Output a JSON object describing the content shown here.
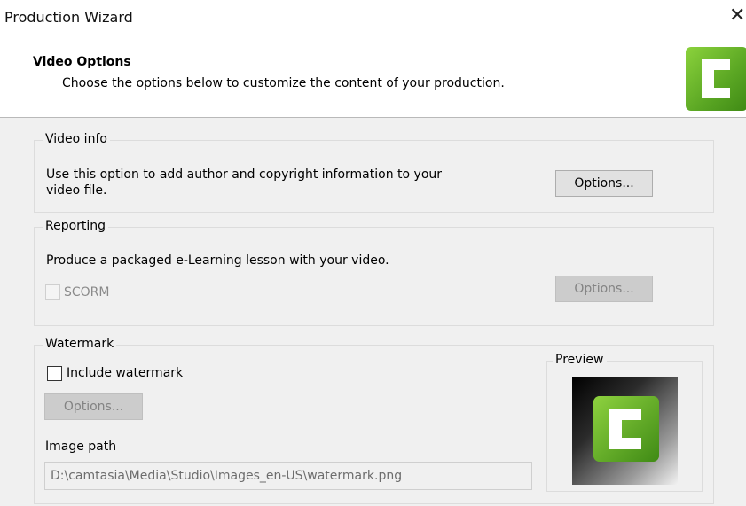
{
  "window": {
    "title": "Production Wizard",
    "close_glyph": "✕"
  },
  "header": {
    "heading": "Video Options",
    "subheading": "Choose the options below to customize the content of your production.",
    "logo_icon": "camtasia-logo-icon"
  },
  "video_info": {
    "label": "Video info",
    "description_line1": "Use this option to add author and copyright information to your",
    "description_line2": "video file.",
    "options_button": "Options..."
  },
  "reporting": {
    "label": "Reporting",
    "description": "Produce a packaged e-Learning lesson with your video.",
    "scorm_label": "SCORM",
    "scorm_checked": false,
    "options_button": "Options..."
  },
  "watermark": {
    "label": "Watermark",
    "include_label": "Include watermark",
    "include_checked": false,
    "options_button": "Options...",
    "image_path_label": "Image path",
    "image_path_value": "D:\\camtasia\\Media\\Studio\\Images_en-US\\watermark.png",
    "preview_label": "Preview"
  },
  "colors": {
    "accent_green": "#5aa623",
    "panel_bg": "#f0f0f0"
  }
}
